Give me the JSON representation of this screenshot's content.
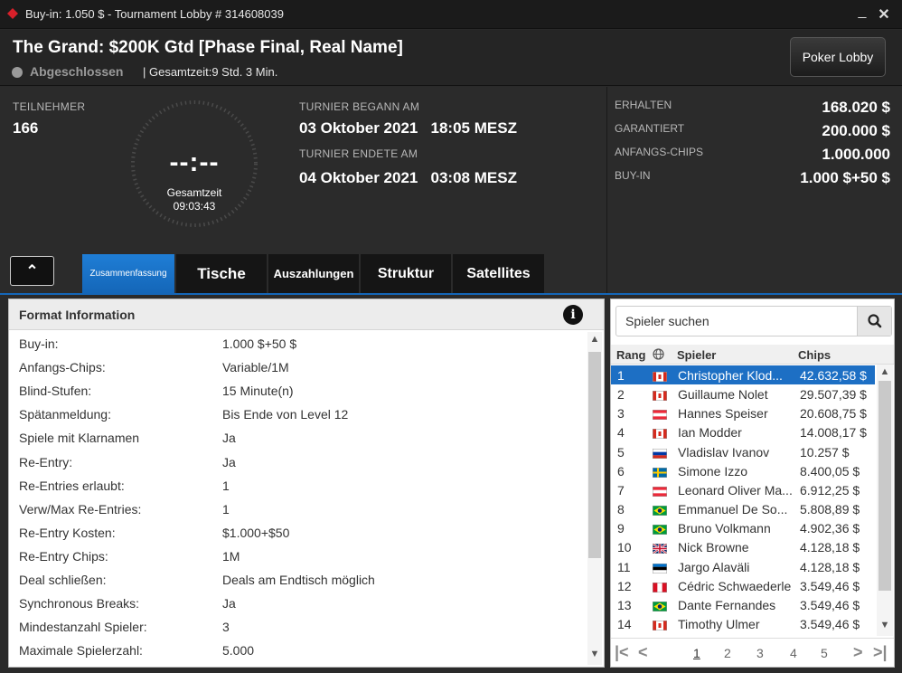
{
  "window": {
    "title": "Buy-in: 1.050 $ - Tournament Lobby # 314608039",
    "minimize": "_",
    "close": "✕"
  },
  "header": {
    "tournament_name": "The Grand: $200K Gtd [Phase Final, Real Name]",
    "status": "Abgeschlossen",
    "total_time": "| Gesamtzeit:9 Std.  3 Min.",
    "poker_lobby_button": "Poker Lobby"
  },
  "info": {
    "participants_label": "TEILNEHMER",
    "participants_value": "166",
    "clock_digits": "--:--",
    "clock_label": "Gesamtzeit",
    "clock_time": "09:03:43",
    "started_label": "TURNIER BEGANN AM",
    "started_value": "03 Oktober 2021   18:05 MESZ",
    "ended_label": "TURNIER ENDETE AM",
    "ended_value": "04 Oktober 2021   03:08 MESZ"
  },
  "right_info": {
    "received_label": "ERHALTEN",
    "received_value": "168.020 $",
    "guaranteed_label": "GARANTIERT",
    "guaranteed_value": "200.000 $",
    "start_chips_label": "ANFANGS-CHIPS",
    "start_chips_value": "1.000.000",
    "buyin_label": "BUY-IN",
    "buyin_value": "1.000 $+50 $"
  },
  "tabs": [
    {
      "label": "Zusammenfassung",
      "active": true
    },
    {
      "label": "Tische"
    },
    {
      "label": "Auszahlungen"
    },
    {
      "label": "Struktur"
    },
    {
      "label": "Satellites"
    }
  ],
  "format": {
    "title": "Format Information",
    "info_icon": "i",
    "rows": [
      {
        "k": "Buy-in:",
        "v": "1.000 $+50 $"
      },
      {
        "k": "Anfangs-Chips:",
        "v": "Variable/1M"
      },
      {
        "k": "Blind-Stufen:",
        "v": "15 Minute(n)"
      },
      {
        "k": "Spätanmeldung:",
        "v": "Bis Ende von Level 12"
      },
      {
        "k": "Spiele mit Klarnamen",
        "v": "Ja"
      },
      {
        "k": "Re-Entry:",
        "v": "Ja"
      },
      {
        "k": "Re-Entries erlaubt:",
        "v": "1"
      },
      {
        "k": "Verw/Max Re-Entries:",
        "v": "1"
      },
      {
        "k": "Re-Entry Kosten:",
        "v": "$1.000+$50"
      },
      {
        "k": "Re-Entry Chips:",
        "v": "1M"
      },
      {
        "k": "Deal schließen:",
        "v": "Deals am Endtisch möglich"
      },
      {
        "k": "Synchronous Breaks:",
        "v": "Ja"
      },
      {
        "k": "Mindestanzahl Spieler:",
        "v": "3"
      },
      {
        "k": "Maximale Spielerzahl:",
        "v": "5.000"
      }
    ]
  },
  "players": {
    "search_placeholder": "Spieler suchen",
    "col_rank": "Rang",
    "col_player": "Spieler",
    "col_chips": "Chips",
    "rows": [
      {
        "rank": "1",
        "flag": "ca",
        "name": "Christopher Klod...",
        "chips": "42.632,58 $",
        "selected": true
      },
      {
        "rank": "2",
        "flag": "ca",
        "name": "Guillaume Nolet",
        "chips": "29.507,39 $"
      },
      {
        "rank": "3",
        "flag": "at",
        "name": "Hannes Speiser",
        "chips": "20.608,75 $"
      },
      {
        "rank": "4",
        "flag": "ca",
        "name": "Ian Modder",
        "chips": "14.008,17 $"
      },
      {
        "rank": "5",
        "flag": "ru",
        "name": "Vladislav Ivanov",
        "chips": "10.257 $"
      },
      {
        "rank": "6",
        "flag": "se",
        "name": "Simone Izzo",
        "chips": "8.400,05 $"
      },
      {
        "rank": "7",
        "flag": "at",
        "name": "Leonard Oliver Ma...",
        "chips": "6.912,25 $"
      },
      {
        "rank": "8",
        "flag": "br",
        "name": "Emmanuel De So...",
        "chips": "5.808,89 $"
      },
      {
        "rank": "9",
        "flag": "br",
        "name": "Bruno Volkmann",
        "chips": "4.902,36 $"
      },
      {
        "rank": "10",
        "flag": "gb",
        "name": "Nick Browne",
        "chips": "4.128,18 $"
      },
      {
        "rank": "11",
        "flag": "ee",
        "name": "Jargo Alaväli",
        "chips": "4.128,18 $"
      },
      {
        "rank": "12",
        "flag": "pe",
        "name": "Cédric Schwaederle",
        "chips": "3.549,46 $"
      },
      {
        "rank": "13",
        "flag": "br",
        "name": "Dante Fernandes",
        "chips": "3.549,46 $"
      },
      {
        "rank": "14",
        "flag": "ca",
        "name": "Timothy Ulmer",
        "chips": "3.549,46 $"
      }
    ],
    "pages": [
      "1",
      "2",
      "3",
      "4",
      "5"
    ],
    "current_page": "1"
  }
}
